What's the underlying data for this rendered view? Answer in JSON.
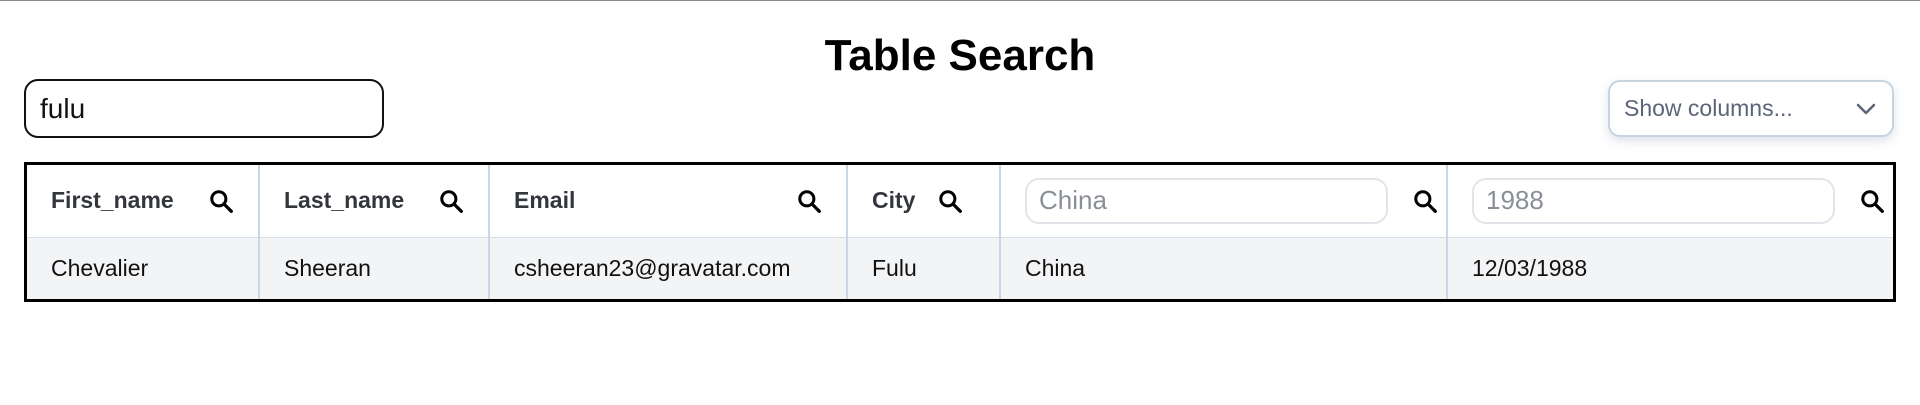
{
  "page": {
    "title": "Table Search"
  },
  "global_search": {
    "value": "fulu"
  },
  "column_picker": {
    "label": "Show columns..."
  },
  "table": {
    "headers": {
      "first_name": "First_name",
      "last_name": "Last_name",
      "email": "Email",
      "city": "City"
    },
    "filters": {
      "country_placeholder": "China",
      "date_placeholder": "1988"
    },
    "rows": [
      {
        "first_name": "Chevalier",
        "last_name": "Sheeran",
        "email": "csheeran23@gravatar.com",
        "city": "Fulu",
        "country": "China",
        "date": "12/03/1988"
      }
    ]
  },
  "icons": {
    "search": "search-icon",
    "chevron": "chevron-down-icon"
  },
  "colors": {
    "row_background": "#f3f4f6",
    "column_divider": "#c9d6e3",
    "table_border": "#000000"
  }
}
